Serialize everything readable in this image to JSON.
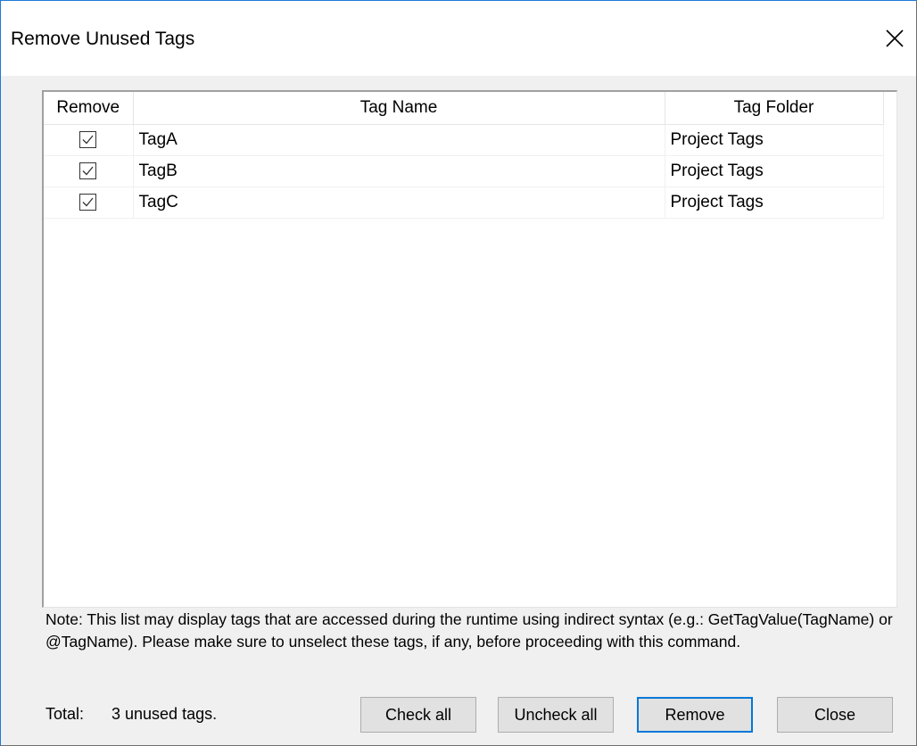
{
  "window": {
    "title": "Remove Unused Tags"
  },
  "table": {
    "columns": [
      "Remove",
      "Tag Name",
      "Tag Folder"
    ],
    "rows": [
      {
        "checked": true,
        "name": "TagA",
        "folder": "Project Tags"
      },
      {
        "checked": true,
        "name": "TagB",
        "folder": "Project Tags"
      },
      {
        "checked": true,
        "name": "TagC",
        "folder": "Project Tags"
      }
    ]
  },
  "note": "Note: This list may display tags that are accessed during the runtime using indirect syntax (e.g.: GetTagValue(TagName) or @TagName). Please make sure to unselect these tags, if any, before proceeding with this command.",
  "total": {
    "label": "Total:",
    "value": "3 unused tags."
  },
  "buttons": {
    "check_all": "Check all",
    "uncheck_all": "Uncheck all",
    "remove": "Remove",
    "close": "Close"
  },
  "icons": {
    "close": "close-icon",
    "checkbox": "checkmark-icon"
  },
  "colors": {
    "accent": "#0078d7",
    "window_border": "#1e7ad8",
    "dialog_bg": "#f0f0f0"
  }
}
